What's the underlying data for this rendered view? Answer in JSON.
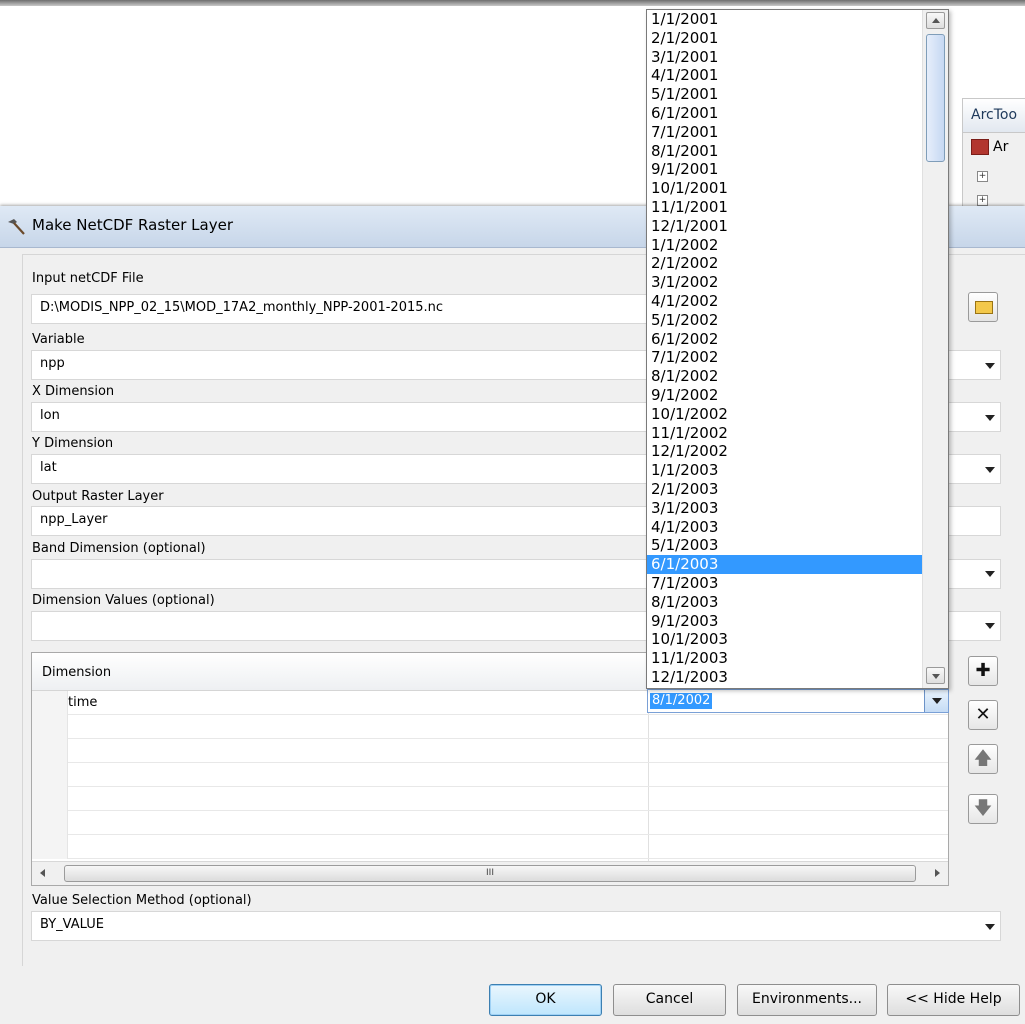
{
  "background": {
    "toolbox_title": "ArcToo",
    "toolbox_item": "Ar"
  },
  "dialog": {
    "title": "Make NetCDF Raster Layer",
    "fields": {
      "input_file": {
        "label": "Input netCDF File",
        "value": "D:\\MODIS_NPP_02_15\\MOD_17A2_monthly_NPP-2001-2015.nc"
      },
      "variable": {
        "label": "Variable",
        "value": "npp"
      },
      "x_dimension": {
        "label": "X Dimension",
        "value": "lon"
      },
      "y_dimension": {
        "label": "Y Dimension",
        "value": "lat"
      },
      "output_layer": {
        "label": "Output Raster Layer",
        "value": "npp_Layer"
      },
      "band_dimension": {
        "label": "Band Dimension (optional)",
        "value": ""
      },
      "dimension_values": {
        "label": "Dimension Values (optional)"
      },
      "value_selection": {
        "label": "Value Selection Method (optional)",
        "value": "BY_VALUE"
      }
    },
    "grid": {
      "header": "Dimension",
      "rows": [
        {
          "dimension": "time",
          "value": "8/1/2002"
        }
      ],
      "hscroll_grip": "III"
    },
    "buttons": {
      "ok": "OK",
      "cancel": "Cancel",
      "environments": "Environments...",
      "hide_help": "<< Hide Help"
    }
  },
  "dropdown": {
    "selected": "6/1/2003",
    "items": [
      "1/1/2001",
      "2/1/2001",
      "3/1/2001",
      "4/1/2001",
      "5/1/2001",
      "6/1/2001",
      "7/1/2001",
      "8/1/2001",
      "9/1/2001",
      "10/1/2001",
      "11/1/2001",
      "12/1/2001",
      "1/1/2002",
      "2/1/2002",
      "3/1/2002",
      "4/1/2002",
      "5/1/2002",
      "6/1/2002",
      "7/1/2002",
      "8/1/2002",
      "9/1/2002",
      "10/1/2002",
      "11/1/2002",
      "12/1/2002",
      "1/1/2003",
      "2/1/2003",
      "3/1/2003",
      "4/1/2003",
      "5/1/2003",
      "6/1/2003",
      "7/1/2003",
      "8/1/2003",
      "9/1/2003",
      "10/1/2003",
      "11/1/2003",
      "12/1/2003"
    ]
  }
}
